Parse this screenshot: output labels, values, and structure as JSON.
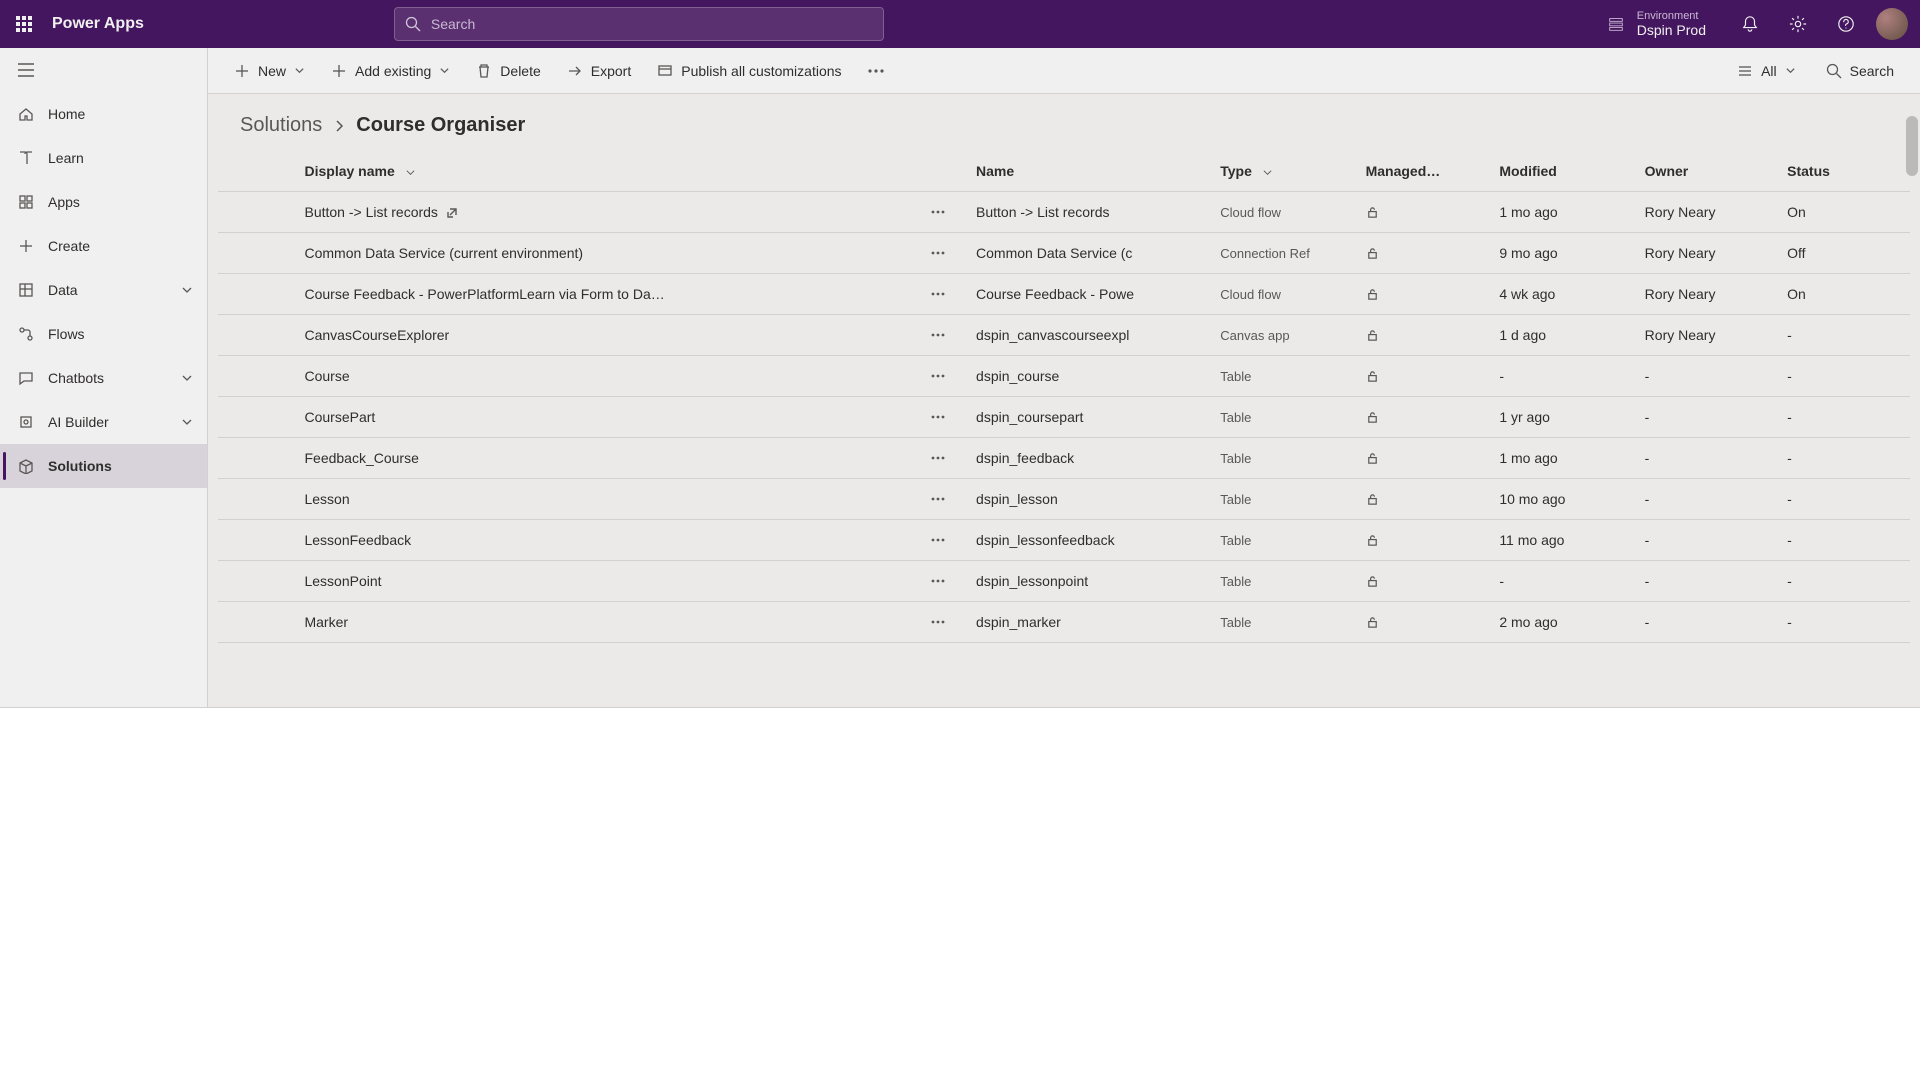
{
  "header": {
    "brand": "Power Apps",
    "search_placeholder": "Search",
    "env_label": "Environment",
    "env_name": "Dspin Prod"
  },
  "sidebar": {
    "items": [
      {
        "id": "home",
        "label": "Home",
        "icon": "home"
      },
      {
        "id": "learn",
        "label": "Learn",
        "icon": "book"
      },
      {
        "id": "apps",
        "label": "Apps",
        "icon": "grid"
      },
      {
        "id": "create",
        "label": "Create",
        "icon": "plus"
      },
      {
        "id": "data",
        "label": "Data",
        "icon": "table",
        "chevron": true
      },
      {
        "id": "flows",
        "label": "Flows",
        "icon": "flow"
      },
      {
        "id": "chatbots",
        "label": "Chatbots",
        "icon": "chat",
        "chevron": true
      },
      {
        "id": "aibuilder",
        "label": "AI Builder",
        "icon": "ai",
        "chevron": true
      },
      {
        "id": "solutions",
        "label": "Solutions",
        "icon": "package",
        "selected": true
      }
    ]
  },
  "commands": {
    "new": "New",
    "add_existing": "Add existing",
    "delete": "Delete",
    "export": "Export",
    "publish": "Publish all customizations",
    "view_all": "All",
    "search": "Search"
  },
  "breadcrumb": {
    "parent": "Solutions",
    "current": "Course Organiser"
  },
  "columns": {
    "display_name": "Display name",
    "name": "Name",
    "type": "Type",
    "managed": "Managed…",
    "modified": "Modified",
    "owner": "Owner",
    "status": "Status"
  },
  "rows": [
    {
      "display": "Button -> List records",
      "ext": true,
      "name": "Button -> List records",
      "type": "Cloud flow",
      "modified": "1 mo ago",
      "owner": "Rory Neary",
      "status": "On"
    },
    {
      "display": "Common Data Service (current environment)",
      "name": "Common Data Service (c",
      "type": "Connection Ref",
      "modified": "9 mo ago",
      "owner": "Rory Neary",
      "status": "Off"
    },
    {
      "display": "Course Feedback - PowerPlatformLearn via Form to Da…",
      "name": "Course Feedback - Powe",
      "type": "Cloud flow",
      "modified": "4 wk ago",
      "owner": "Rory Neary",
      "status": "On"
    },
    {
      "display": "CanvasCourseExplorer",
      "name": "dspin_canvascourseexpl",
      "type": "Canvas app",
      "modified": "1 d ago",
      "owner": "Rory Neary",
      "status": "-"
    },
    {
      "display": "Course",
      "name": "dspin_course",
      "type": "Table",
      "modified": "-",
      "owner": "-",
      "status": "-"
    },
    {
      "display": "CoursePart",
      "name": "dspin_coursepart",
      "type": "Table",
      "modified": "1 yr ago",
      "owner": "-",
      "status": "-"
    },
    {
      "display": "Feedback_Course",
      "name": "dspin_feedback",
      "type": "Table",
      "modified": "1 mo ago",
      "owner": "-",
      "status": "-"
    },
    {
      "display": "Lesson",
      "name": "dspin_lesson",
      "type": "Table",
      "modified": "10 mo ago",
      "owner": "-",
      "status": "-"
    },
    {
      "display": "LessonFeedback",
      "name": "dspin_lessonfeedback",
      "type": "Table",
      "modified": "11 mo ago",
      "owner": "-",
      "status": "-"
    },
    {
      "display": "LessonPoint",
      "name": "dspin_lessonpoint",
      "type": "Table",
      "modified": "-",
      "owner": "-",
      "status": "-"
    },
    {
      "display": "Marker",
      "name": "dspin_marker",
      "type": "Table",
      "modified": "2 mo ago",
      "owner": "-",
      "status": "-"
    }
  ]
}
